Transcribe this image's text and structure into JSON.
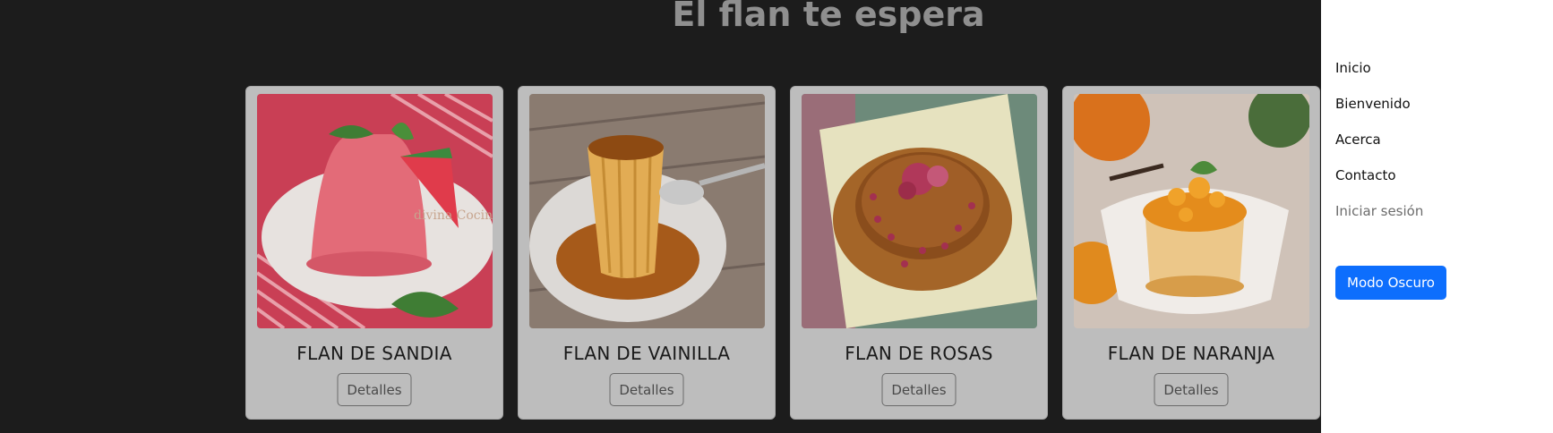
{
  "page": {
    "title": "El flan te espera"
  },
  "cards": [
    {
      "title": "FLAN DE SANDIA",
      "button": "Detalles"
    },
    {
      "title": "FLAN DE VAINILLA",
      "button": "Detalles"
    },
    {
      "title": "FLAN DE ROSAS",
      "button": "Detalles"
    },
    {
      "title": "FLAN DE NARANJA",
      "button": "Detalles"
    }
  ],
  "offcanvas": {
    "nav": [
      {
        "label": "Inicio"
      },
      {
        "label": "Bienvenido"
      },
      {
        "label": "Acerca"
      },
      {
        "label": "Contacto"
      },
      {
        "label": "Iniciar sesión"
      }
    ],
    "dark_mode_button": "Modo Oscuro"
  },
  "image_watermark": "divina Cocina",
  "colors": {
    "background": "#1c1c1c",
    "card": "#bdbdbd",
    "primary": "#0d6efd"
  }
}
